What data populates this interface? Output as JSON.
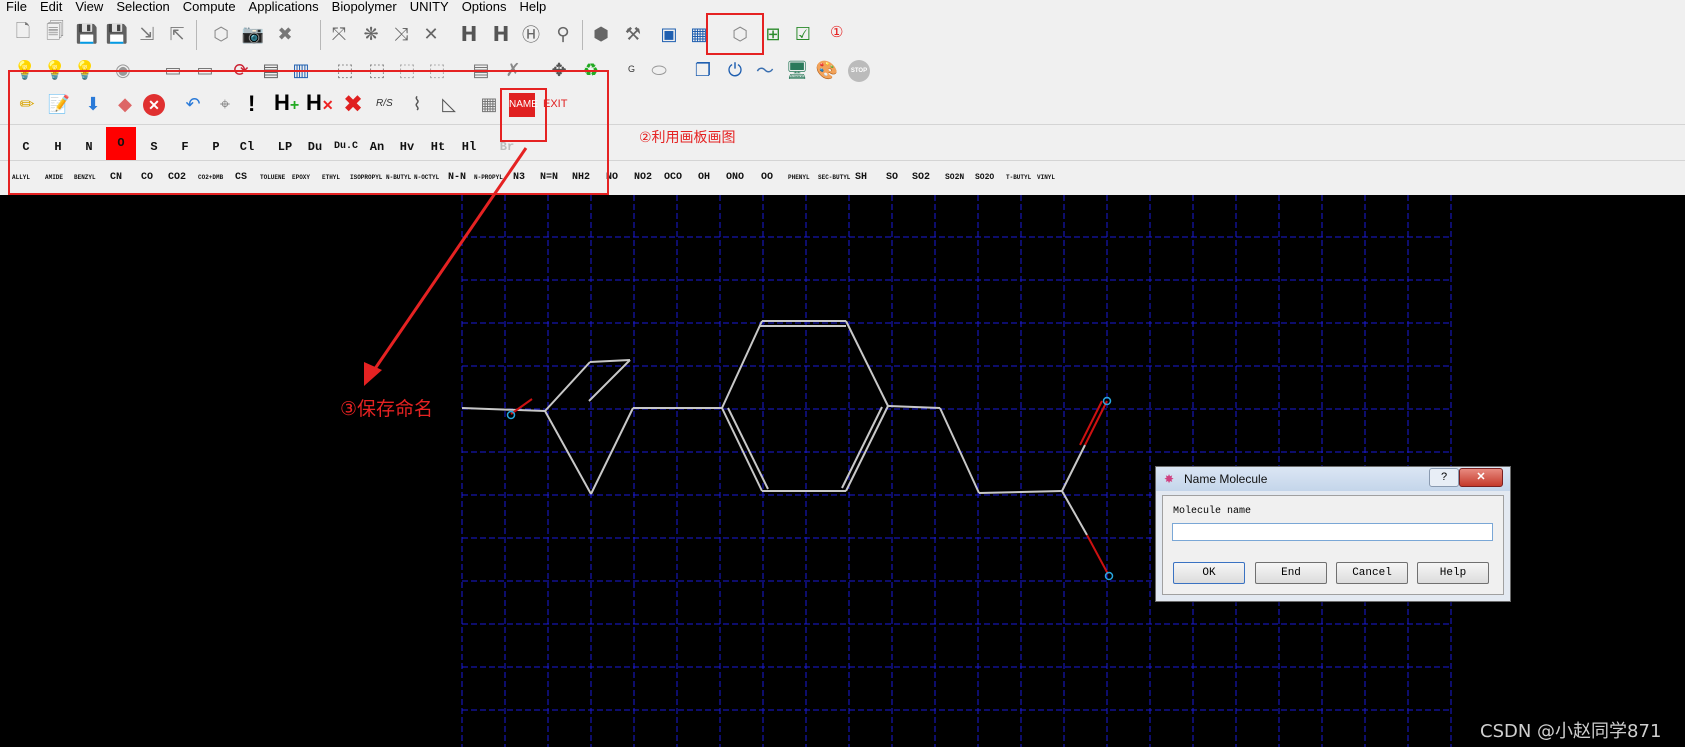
{
  "menu": [
    "File",
    "Edit",
    "View",
    "Selection",
    "Compute",
    "Applications",
    "Biopolymer",
    "UNITY",
    "Options",
    "Help"
  ],
  "toolbar": {
    "h_label": "H",
    "g_label": "G",
    "stop_label": "STOP",
    "name_label": "NAME",
    "exit_label": "EXIT",
    "rs_label": "R/S",
    "exclaim_label": "!"
  },
  "atoms": [
    "C",
    "H",
    "N",
    "O",
    "S",
    "F",
    "P",
    "Cl",
    "LP",
    "Du",
    "Du.C",
    "An",
    "Hv",
    "Ht",
    "Hl",
    "Br"
  ],
  "fragments": [
    "ALLYL",
    "AMIDE",
    "BENZYL",
    "CN",
    "CO",
    "CO2",
    "CO2+DMB",
    "CS",
    "TOLUENE",
    "EPOXY",
    "ETHYL",
    "ISOPROPYL",
    "N-BUTYL",
    "N-OCTYL",
    "N-N",
    "N-PROPYL",
    "N3",
    "N=N",
    "NH2",
    "NO",
    "NO2",
    "OCO",
    "OH",
    "ONO",
    "OO",
    "PHENYL",
    "SEC-BUTYL",
    "SH",
    "SO",
    "SO2",
    "SO2N",
    "SO2O",
    "T-BUTYL",
    "VINYL"
  ],
  "annotations": {
    "step1": "①",
    "step2": "②利用画板画图",
    "step3": "③保存命名"
  },
  "dialog": {
    "title": "Name Molecule",
    "help_glyph": "?",
    "close_glyph": "✕",
    "field_label": "Molecule name",
    "field_value": "",
    "buttons": [
      "OK",
      "End",
      "Cancel",
      "Help"
    ]
  },
  "watermark": "CSDN @小赵同学871",
  "colors": {
    "accent_red": "#e52222",
    "grid": "#1a1ad8",
    "bond": "#c8c8c8",
    "bond_oxygen": "#cc1111"
  }
}
